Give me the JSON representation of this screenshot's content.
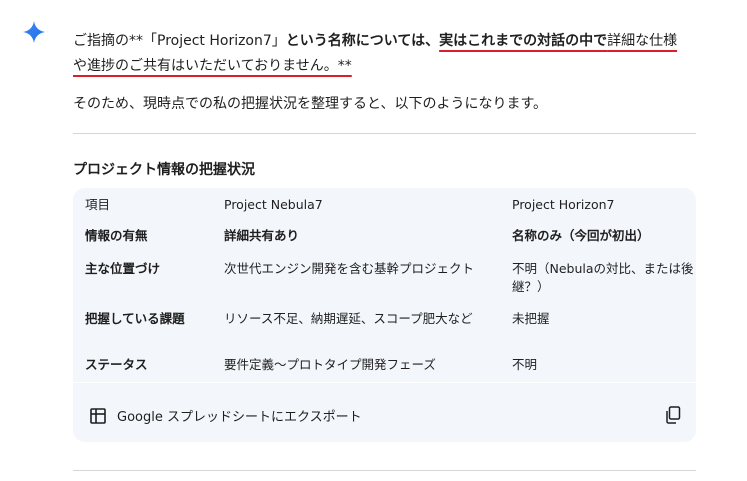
{
  "response": {
    "para1_prefix": "ご指摘の**「Project Horizon7」",
    "para1_bold_a": "という名称については、",
    "para1_bold_b": "実はこれまでの対話の中で",
    "para1_tail": "詳細な仕様",
    "para1_line2": "や進捗のご共有はいただいておりません。**",
    "para2": "そのため、現時点での私の把握状況を整理すると、以下のようになります。",
    "section_title": "プロジェクト情報の把握状況"
  },
  "table": {
    "headers": [
      "項目",
      "Project Nebula7",
      "Project Horizon7"
    ],
    "rows": [
      [
        "情報の有無",
        "詳細共有あり",
        "名称のみ（今回が初出）"
      ],
      [
        "主な位置づけ",
        "次世代エンジン開発を含む基幹プロジェクト",
        "不明（Nebulaの対比、または後継？）"
      ],
      [
        "把握している課題",
        "リソース不足、納期遅延、スコープ肥大など",
        "未把握"
      ],
      [
        "ステータス",
        "要件定義〜プロトタイプ開発フェーズ",
        "不明"
      ]
    ]
  },
  "actions": {
    "export_label": "Google スプレッドシートにエクスポート",
    "export_icon": "table-grid-icon",
    "copy_icon": "copy-icon"
  },
  "colors": {
    "spark": "#4285f4",
    "underline": "#d8202d",
    "card_bg": "#f3f6fb"
  }
}
